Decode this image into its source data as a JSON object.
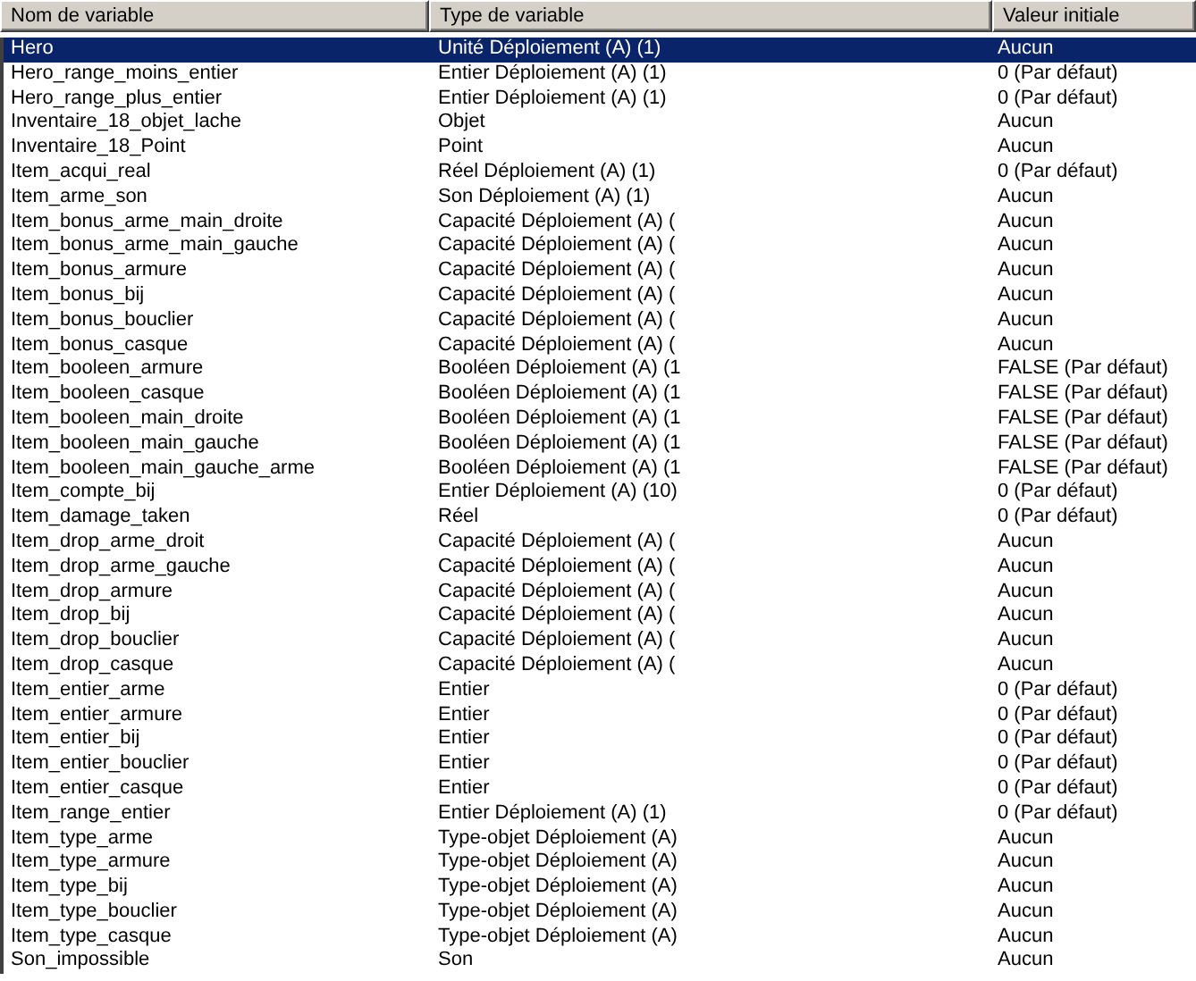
{
  "table": {
    "columns": [
      "Nom de variable",
      "Type de variable",
      "Valeur initiale"
    ],
    "rows": [
      {
        "name": "Hero",
        "type": "Unité Déploiement (A) (1)",
        "value": "Aucun",
        "selected": true
      },
      {
        "name": "Hero_range_moins_entier",
        "type": "Entier Déploiement (A) (1)",
        "value": "0 (Par défaut)",
        "selected": false
      },
      {
        "name": "Hero_range_plus_entier",
        "type": "Entier Déploiement (A) (1)",
        "value": "0 (Par défaut)",
        "selected": false
      },
      {
        "name": "Inventaire_18_objet_lache",
        "type": "Objet",
        "value": "Aucun",
        "selected": false
      },
      {
        "name": "Inventaire_18_Point",
        "type": "Point",
        "value": "Aucun",
        "selected": false
      },
      {
        "name": "Item_acqui_real",
        "type": "Réel Déploiement (A) (1)",
        "value": "0 (Par défaut)",
        "selected": false
      },
      {
        "name": "Item_arme_son",
        "type": "Son Déploiement (A) (1)",
        "value": "Aucun",
        "selected": false
      },
      {
        "name": "Item_bonus_arme_main_droite",
        "type": "Capacité Déploiement (A) (",
        "value": "Aucun",
        "selected": false
      },
      {
        "name": "Item_bonus_arme_main_gauche",
        "type": "Capacité Déploiement (A) (",
        "value": "Aucun",
        "selected": false
      },
      {
        "name": "Item_bonus_armure",
        "type": "Capacité Déploiement (A) (",
        "value": "Aucun",
        "selected": false
      },
      {
        "name": "Item_bonus_bij",
        "type": "Capacité Déploiement (A) (",
        "value": "Aucun",
        "selected": false
      },
      {
        "name": "Item_bonus_bouclier",
        "type": "Capacité Déploiement (A) (",
        "value": "Aucun",
        "selected": false
      },
      {
        "name": "Item_bonus_casque",
        "type": "Capacité Déploiement (A) (",
        "value": "Aucun",
        "selected": false
      },
      {
        "name": "Item_booleen_armure",
        "type": "Booléen Déploiement (A) (1",
        "value": "FALSE (Par défaut)",
        "selected": false
      },
      {
        "name": "Item_booleen_casque",
        "type": "Booléen Déploiement (A) (1",
        "value": "FALSE (Par défaut)",
        "selected": false
      },
      {
        "name": "Item_booleen_main_droite",
        "type": "Booléen Déploiement (A) (1",
        "value": "FALSE (Par défaut)",
        "selected": false
      },
      {
        "name": "Item_booleen_main_gauche",
        "type": "Booléen Déploiement (A) (1",
        "value": "FALSE (Par défaut)",
        "selected": false
      },
      {
        "name": "Item_booleen_main_gauche_arme",
        "type": "Booléen Déploiement (A) (1",
        "value": "FALSE (Par défaut)",
        "selected": false
      },
      {
        "name": "Item_compte_bij",
        "type": "Entier Déploiement (A) (10)",
        "value": "0 (Par défaut)",
        "selected": false
      },
      {
        "name": "Item_damage_taken",
        "type": "Réel",
        "value": "0 (Par défaut)",
        "selected": false
      },
      {
        "name": "Item_drop_arme_droit",
        "type": "Capacité Déploiement (A) (",
        "value": "Aucun",
        "selected": false
      },
      {
        "name": "Item_drop_arme_gauche",
        "type": "Capacité Déploiement (A) (",
        "value": "Aucun",
        "selected": false
      },
      {
        "name": "Item_drop_armure",
        "type": "Capacité Déploiement (A) (",
        "value": "Aucun",
        "selected": false
      },
      {
        "name": "Item_drop_bij",
        "type": "Capacité Déploiement (A) (",
        "value": "Aucun",
        "selected": false
      },
      {
        "name": "Item_drop_bouclier",
        "type": "Capacité Déploiement (A) (",
        "value": "Aucun",
        "selected": false
      },
      {
        "name": "Item_drop_casque",
        "type": "Capacité Déploiement (A) (",
        "value": "Aucun",
        "selected": false
      },
      {
        "name": "Item_entier_arme",
        "type": "Entier",
        "value": "0 (Par défaut)",
        "selected": false
      },
      {
        "name": "Item_entier_armure",
        "type": "Entier",
        "value": "0 (Par défaut)",
        "selected": false
      },
      {
        "name": "Item_entier_bij",
        "type": "Entier",
        "value": "0 (Par défaut)",
        "selected": false
      },
      {
        "name": "Item_entier_bouclier",
        "type": "Entier",
        "value": "0 (Par défaut)",
        "selected": false
      },
      {
        "name": "Item_entier_casque",
        "type": "Entier",
        "value": "0 (Par défaut)",
        "selected": false
      },
      {
        "name": "Item_range_entier",
        "type": "Entier Déploiement (A) (1)",
        "value": "0 (Par défaut)",
        "selected": false
      },
      {
        "name": "Item_type_arme",
        "type": "Type-objet Déploiement (A)",
        "value": "Aucun",
        "selected": false
      },
      {
        "name": "Item_type_armure",
        "type": "Type-objet Déploiement (A)",
        "value": "Aucun",
        "selected": false
      },
      {
        "name": "Item_type_bij",
        "type": "Type-objet Déploiement (A)",
        "value": "Aucun",
        "selected": false
      },
      {
        "name": "Item_type_bouclier",
        "type": "Type-objet Déploiement (A)",
        "value": "Aucun",
        "selected": false
      },
      {
        "name": "Item_type_casque",
        "type": "Type-objet Déploiement (A)",
        "value": "Aucun",
        "selected": false
      },
      {
        "name": "Son_impossible",
        "type": "Son",
        "value": "Aucun",
        "selected": false
      }
    ]
  }
}
